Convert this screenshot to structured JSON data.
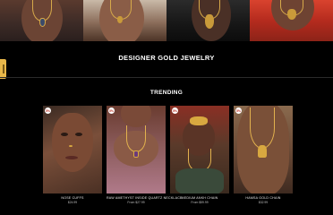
{
  "hero": {
    "images": [
      {
        "name": "model-with-gold-pendant-1"
      },
      {
        "name": "model-with-gold-pendant-2"
      },
      {
        "name": "model-with-gold-pendant-3"
      },
      {
        "name": "model-with-gold-pendant-4"
      }
    ]
  },
  "main": {
    "title": "DESIGNER GOLD JEWELRY"
  },
  "trending": {
    "title": "TRENDING",
    "products": [
      {
        "badge": "5%",
        "name": "NOSE CUFFS",
        "price": "$24.99"
      },
      {
        "badge": "5%",
        "name": "RAW AMETHYST INSIDE QUARTZ NECKLACE",
        "price": "From $27.99"
      },
      {
        "badge": "5%",
        "name": "MEDIUM ANKH CHAIN",
        "price": "From $59.99"
      },
      {
        "badge": "5%",
        "name": "HAMSA GOLD CHAIN",
        "price": "$32.99"
      }
    ]
  },
  "colors": {
    "background": "#000000",
    "accent_tab": "#e9b84a",
    "badge_text": "#c0392b"
  }
}
